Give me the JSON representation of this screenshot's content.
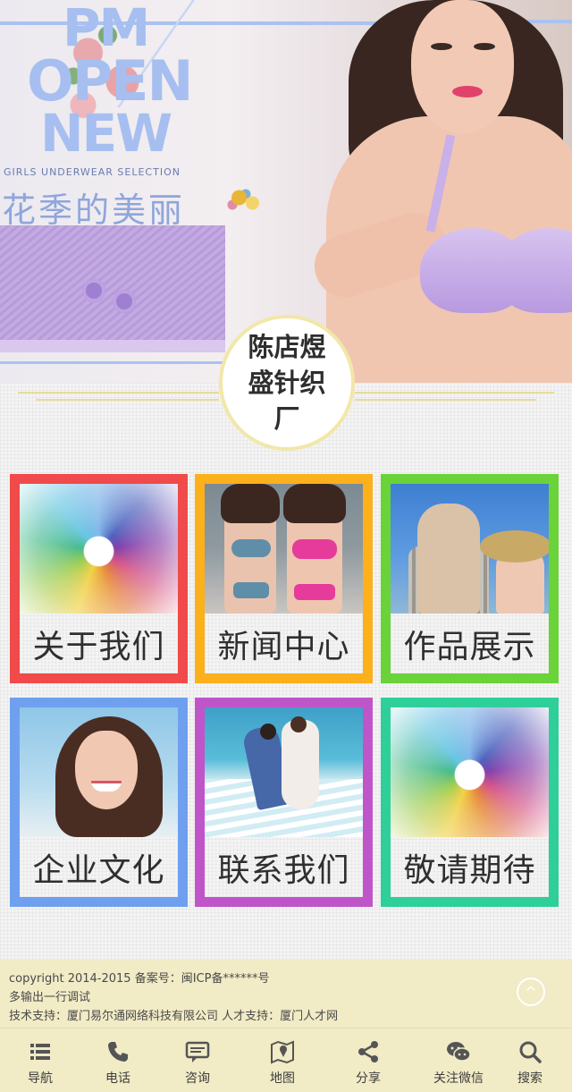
{
  "banner": {
    "logo_lines": [
      "PM",
      "OPEN",
      "NEW"
    ],
    "tagline": "GIRLS UNDERWEAR SELECTION",
    "headline": "花季的美丽",
    "badge_line1": "陈店煜",
    "badge_line2": "盛针织厂"
  },
  "tiles": [
    {
      "label": "关于我们",
      "border": "#f04a4a",
      "icon": "pencils-photo"
    },
    {
      "label": "新闻中心",
      "border": "#fbb01c",
      "icon": "bikini-photo"
    },
    {
      "label": "作品展示",
      "border": "#6ad33a",
      "icon": "couple-photo"
    },
    {
      "label": "企业文化",
      "border": "#6fa0f0",
      "icon": "smiling-woman-photo"
    },
    {
      "label": "联系我们",
      "border": "#bf55c9",
      "icon": "beach-wedding-photo"
    },
    {
      "label": "敬请期待",
      "border": "#2fcf9a",
      "icon": "pencils-photo"
    }
  ],
  "footer": {
    "line1": "copyright 2014-2015 备案号：闽ICP备******号",
    "line2": "多输出一行调试",
    "line3": "技术支持：厦门易尔通网络科技有限公司 人才支持：厦门人才网",
    "top_glyph": "^"
  },
  "nav": [
    {
      "label": "导航",
      "icon": "list-icon"
    },
    {
      "label": "电话",
      "icon": "phone-icon"
    },
    {
      "label": "咨询",
      "icon": "chat-icon"
    },
    {
      "label": "地图",
      "icon": "map-icon"
    },
    {
      "label": "分享",
      "icon": "share-icon"
    },
    {
      "label": "关注微信",
      "icon": "wechat-icon"
    },
    {
      "label": "搜索",
      "icon": "search-icon"
    }
  ]
}
